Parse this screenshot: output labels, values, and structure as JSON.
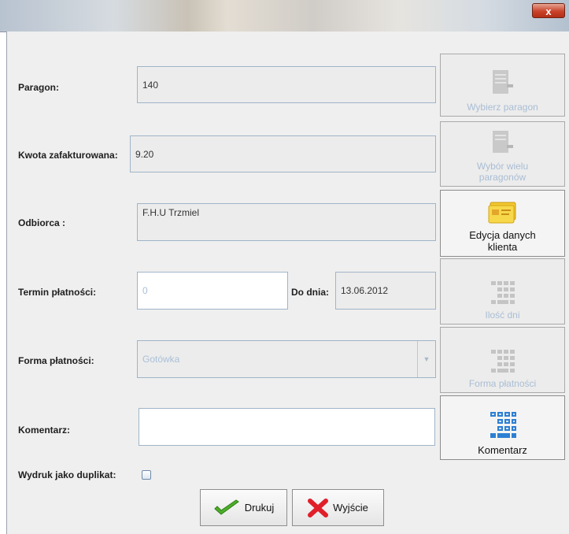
{
  "window": {
    "close_glyph": "x"
  },
  "paragon": {
    "label": "Paragon:",
    "value": "140"
  },
  "kwota": {
    "label": "Kwota zafakturowana:",
    "value": "9.20"
  },
  "odbiorca": {
    "label": "Odbiorca :",
    "value": "F.H.U Trzmiel"
  },
  "termin": {
    "label": "Termin płatności:",
    "value": "0",
    "do_dnia_label": "Do dnia:",
    "do_dnia_value": "13.06.2012"
  },
  "forma": {
    "label": "Forma płatności:",
    "value": "Gotówka"
  },
  "komentarz": {
    "label": "Komentarz:",
    "value": ""
  },
  "duplikat": {
    "label": "Wydruk jako duplikat:",
    "checked": false
  },
  "side_buttons": {
    "wybierz_paragon": "Wybierz paragon",
    "wybor_wielu_1": "Wybór wielu",
    "wybor_wielu_2": "paragonów",
    "edycja_1": "Edycja danych",
    "edycja_2": "klienta",
    "ilosc_dni": "Ilość dni",
    "forma_platnosci": "Forma płatności",
    "komentarz": "Komentarz"
  },
  "actions": {
    "print": "Drukuj",
    "exit": "Wyjście"
  },
  "colors": {
    "field_border": "#9fb4c8",
    "disabled_text": "#a9bdd4",
    "print_check": "#4caf2a",
    "exit_x": "#e0202a"
  }
}
